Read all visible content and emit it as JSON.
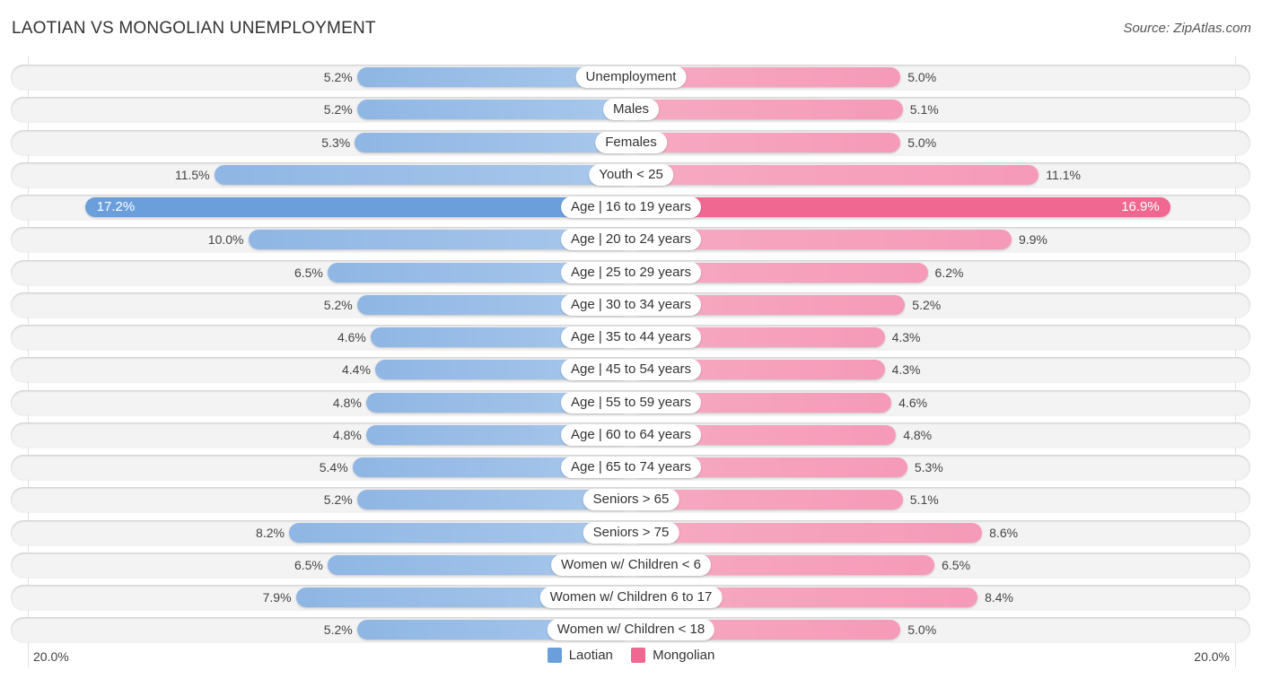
{
  "header": {
    "title": "LAOTIAN VS MONGOLIAN UNEMPLOYMENT",
    "source": "Source: ZipAtlas.com"
  },
  "colors": {
    "laotian": "#6a9fdc",
    "laotian_light": "#a9c8ec",
    "mongolian": "#f06892",
    "mongolian_light": "#f7aac2"
  },
  "chart_data": {
    "type": "bar",
    "orientation": "horizontal-diverging",
    "title": "LAOTIAN VS MONGOLIAN UNEMPLOYMENT",
    "xlabel": "",
    "ylabel": "",
    "axis_min_label": "20.0%",
    "axis_max_label": "20.0%",
    "xlim": [
      0,
      20
    ],
    "legend_position": "bottom-center",
    "categories": [
      "Unemployment",
      "Males",
      "Females",
      "Youth < 25",
      "Age | 16 to 19 years",
      "Age | 20 to 24 years",
      "Age | 25 to 29 years",
      "Age | 30 to 34 years",
      "Age | 35 to 44 years",
      "Age | 45 to 54 years",
      "Age | 55 to 59 years",
      "Age | 60 to 64 years",
      "Age | 65 to 74 years",
      "Seniors > 65",
      "Seniors > 75",
      "Women w/ Children < 6",
      "Women w/ Children 6 to 17",
      "Women w/ Children < 18"
    ],
    "series": [
      {
        "name": "Laotian",
        "side": "left",
        "values": [
          5.2,
          5.2,
          5.3,
          11.5,
          17.2,
          10.0,
          6.5,
          5.2,
          4.6,
          4.4,
          4.8,
          4.8,
          5.4,
          5.2,
          8.2,
          6.5,
          7.9,
          5.2
        ],
        "labels": [
          "5.2%",
          "5.2%",
          "5.3%",
          "11.5%",
          "17.2%",
          "10.0%",
          "6.5%",
          "5.2%",
          "4.6%",
          "4.4%",
          "4.8%",
          "4.8%",
          "5.4%",
          "5.2%",
          "8.2%",
          "6.5%",
          "7.9%",
          "5.2%"
        ]
      },
      {
        "name": "Mongolian",
        "side": "right",
        "values": [
          5.0,
          5.1,
          5.0,
          11.1,
          16.9,
          9.9,
          6.2,
          5.2,
          4.3,
          4.3,
          4.6,
          4.8,
          5.3,
          5.1,
          8.6,
          6.5,
          8.4,
          5.0
        ],
        "labels": [
          "5.0%",
          "5.1%",
          "5.0%",
          "11.1%",
          "16.9%",
          "9.9%",
          "6.2%",
          "5.2%",
          "4.3%",
          "4.3%",
          "4.6%",
          "4.8%",
          "5.3%",
          "5.1%",
          "8.6%",
          "6.5%",
          "8.4%",
          "5.0%"
        ]
      }
    ]
  },
  "legend": {
    "items": [
      {
        "label": "Laotian"
      },
      {
        "label": "Mongolian"
      }
    ]
  }
}
